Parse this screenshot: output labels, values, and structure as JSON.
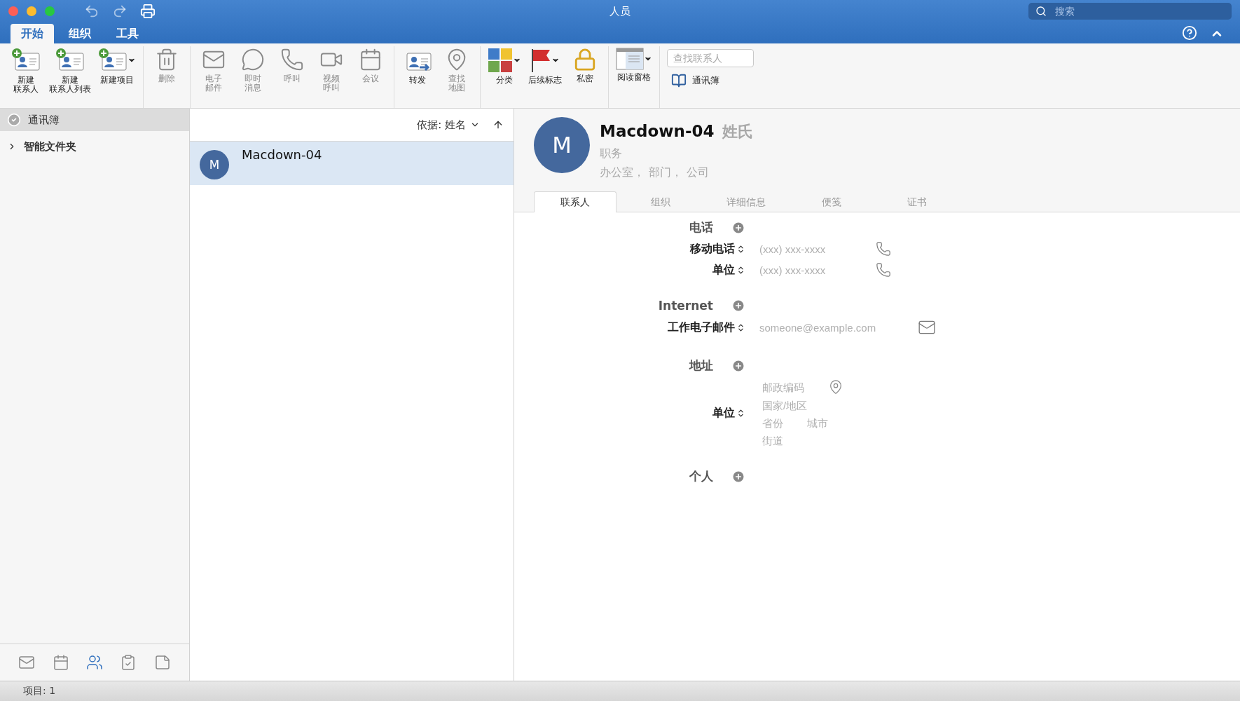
{
  "window": {
    "title": "人员",
    "search": {
      "placeholder": "搜索"
    }
  },
  "ribbon_tabs": [
    {
      "label": "开始",
      "selected": true
    },
    {
      "label": "组织",
      "selected": false
    },
    {
      "label": "工具",
      "selected": false
    }
  ],
  "ribbon": {
    "groups": [
      {
        "buttons": [
          {
            "kind": "new-contact",
            "label_lines": [
              "新建",
              "联系人"
            ],
            "disabled": false,
            "dropdown": false
          },
          {
            "kind": "new-list",
            "label_lines": [
              "新建",
              "联系人列表"
            ],
            "disabled": false,
            "dropdown": false
          },
          {
            "kind": "new-item",
            "label_lines": [
              "新建项目"
            ],
            "disabled": false,
            "dropdown": true
          }
        ]
      },
      {
        "buttons": [
          {
            "kind": "delete",
            "label_lines": [
              "删除"
            ],
            "disabled": true,
            "dropdown": false
          }
        ]
      },
      {
        "buttons": [
          {
            "kind": "email",
            "label_lines": [
              "电子",
              "邮件"
            ],
            "disabled": true,
            "dropdown": false
          },
          {
            "kind": "chat",
            "label_lines": [
              "即时",
              "消息"
            ],
            "disabled": true,
            "dropdown": false
          },
          {
            "kind": "call",
            "label_lines": [
              "呼叫"
            ],
            "disabled": true,
            "dropdown": false
          },
          {
            "kind": "video",
            "label_lines": [
              "视频",
              "呼叫"
            ],
            "disabled": true,
            "dropdown": false
          },
          {
            "kind": "meeting",
            "label_lines": [
              "会议"
            ],
            "disabled": true,
            "dropdown": false
          }
        ]
      },
      {
        "buttons": [
          {
            "kind": "forward",
            "label_lines": [
              "转发"
            ],
            "disabled": false,
            "dropdown": false
          },
          {
            "kind": "map",
            "label_lines": [
              "查找",
              "地图"
            ],
            "disabled": true,
            "dropdown": false
          }
        ]
      },
      {
        "buttons": [
          {
            "kind": "categorize",
            "label_lines": [
              "分类"
            ],
            "disabled": false,
            "dropdown": true
          },
          {
            "kind": "flag",
            "label_lines": [
              "后续标志"
            ],
            "disabled": false,
            "dropdown": true
          },
          {
            "kind": "private",
            "label_lines": [
              "私密"
            ],
            "disabled": false,
            "dropdown": false
          }
        ]
      },
      {
        "buttons": [
          {
            "kind": "reading-pane",
            "label_lines": [
              "阅读窗格"
            ],
            "disabled": false,
            "dropdown": true
          }
        ]
      }
    ],
    "find": {
      "placeholder": "查找联系人",
      "address_book": "通讯簿"
    }
  },
  "sidebar": {
    "items": [
      {
        "label": "通讯簿",
        "selected": true,
        "kind": "folder"
      },
      {
        "label": "智能文件夹",
        "selected": false,
        "kind": "group",
        "expanded": false
      }
    ],
    "nav": [
      {
        "kind": "mail",
        "selected": false
      },
      {
        "kind": "calendar",
        "selected": false
      },
      {
        "kind": "people",
        "selected": true
      },
      {
        "kind": "tasks",
        "selected": false
      },
      {
        "kind": "notes",
        "selected": false
      }
    ]
  },
  "list": {
    "sort_label": "依据: 姓名",
    "contacts": [
      {
        "initial": "M",
        "name": "Macdown-04",
        "selected": true
      }
    ]
  },
  "detail": {
    "initial": "M",
    "name": "Macdown-04",
    "surname": "姓氏",
    "job_title": "职务",
    "org": [
      "办公室，",
      "部门，",
      "公司"
    ],
    "tabs": [
      {
        "label": "联系人",
        "selected": true
      },
      {
        "label": "组织",
        "selected": false
      },
      {
        "label": "详细信息",
        "selected": false
      },
      {
        "label": "便笺",
        "selected": false
      },
      {
        "label": "证书",
        "selected": false
      }
    ],
    "sections": [
      {
        "heading": "电话",
        "rows": [
          {
            "kind": "phone",
            "label": "移动电话",
            "placeholder": "(xxx) xxx-xxxx"
          },
          {
            "kind": "phone",
            "label": "单位",
            "placeholder": "(xxx) xxx-xxxx"
          }
        ]
      },
      {
        "heading": "Internet",
        "rows": [
          {
            "kind": "email",
            "label": "工作电子邮件",
            "placeholder": "someone@example.com"
          }
        ]
      },
      {
        "heading": "地址",
        "rows": [
          {
            "kind": "address",
            "label": "单位",
            "lines": [
              [
                {
                  "placeholder": "邮政编码"
                }
              ],
              [
                {
                  "placeholder": "国家/地区"
                }
              ],
              [
                {
                  "placeholder": "省份"
                },
                {
                  "placeholder": "城市"
                }
              ],
              [
                {
                  "placeholder": "街道"
                }
              ]
            ]
          }
        ]
      },
      {
        "heading": "个人"
      }
    ]
  },
  "status_bar": {
    "text": "项目: 1"
  }
}
